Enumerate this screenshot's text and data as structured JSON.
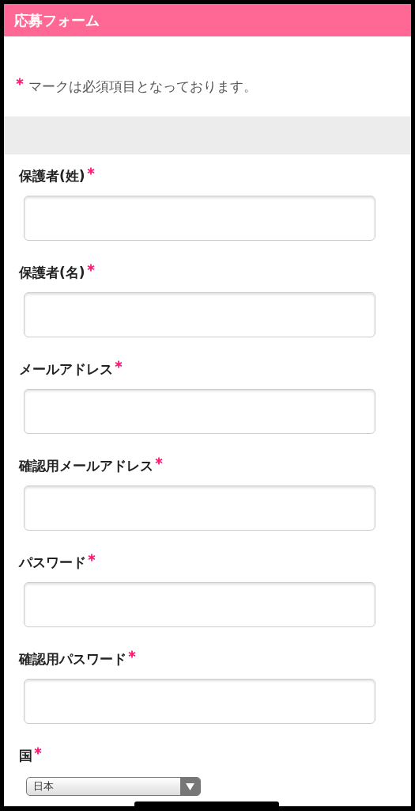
{
  "header": {
    "title": "応募フォーム"
  },
  "note": {
    "text": "マークは必須項目となっております。"
  },
  "fields": [
    {
      "label": "保護者(姓)",
      "required": true
    },
    {
      "label": "保護者(名)",
      "required": true
    },
    {
      "label": "メールアドレス",
      "required": true
    },
    {
      "label": "確認用メールアドレス",
      "required": true
    },
    {
      "label": "パスワード",
      "required": true
    },
    {
      "label": "確認用パスワード",
      "required": true
    }
  ],
  "country": {
    "label": "国",
    "required": true,
    "value": "日本"
  }
}
